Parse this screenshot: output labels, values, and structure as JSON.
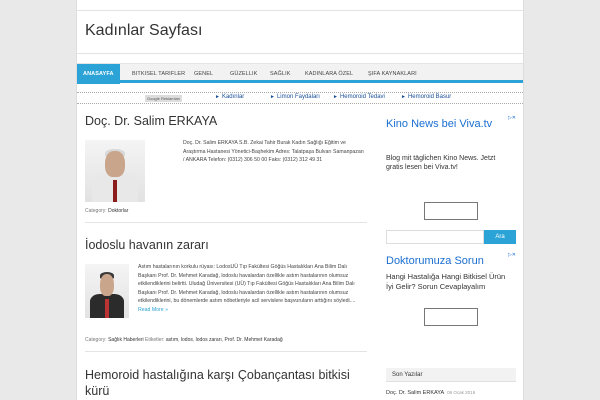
{
  "site": {
    "title": "Kadınlar Sayfası"
  },
  "nav": {
    "items": [
      {
        "label": "ANASAYFA"
      },
      {
        "label": "BITKISEL TARIFLER"
      },
      {
        "label": "GENEL"
      },
      {
        "label": "GÜZELLIK"
      },
      {
        "label": "SAĞLIK"
      },
      {
        "label": "KADINLARA ÖZEL"
      },
      {
        "label": "ŞIFA KAYNAKLARI"
      }
    ]
  },
  "adlinks": {
    "badge": "Google Reklamları",
    "items": [
      {
        "label": "Kadınlar"
      },
      {
        "label": "Limon Faydaları"
      },
      {
        "label": "Hemoroid Tedavi"
      },
      {
        "label": "Hemoroid Basur"
      }
    ]
  },
  "posts": [
    {
      "title": "Doç. Dr. Salim ERKAYA",
      "excerpt": "Doç. Dr. Salim ERKAYA S.B. Zekai Tahir Burak Kadın Sağlığı Eğitim ve Araştırma Hastanesi Yönetici-Başhekim Adres: Talatpaşa Bulvarı Samanpazarı / ANKARA Telefon: (0312) 306 50 00 Faks: (0312) 312 49 31",
      "category_label": "Category:",
      "category": "Doktorlar"
    },
    {
      "title": "İodoslu havanın zararı",
      "excerpt": "Astım hastalarının korkulu rüyası: LodosUÜ Tıp Fakültesi Göğüs Hastalıkları Ana Bilim Dalı Başkanı Prof. Dr. Mehmet Karadağ, lodoslu havalardan özellikle astım hastalarının olumsuz etkilendiklerini belirtti. Uludağ Üniversitesi (UÜ) Tıp Fakültesi Göğüs Hastalıkları Ana Bilim Dalı Başkanı Prof. Dr. Mehmet Karadağ, lodoslu havalardan özellikle astım hastalarının olumsuz etkilendiklerini, bu dönemlerde astım nöbetleriyle acil servislere başvuruların arttığını söyledi....",
      "readmore": "Read More »",
      "category_label": "Category:",
      "category": "Sağlık Haberleri",
      "tags_label": "Etiketler:",
      "tags": [
        "astım",
        "lodos",
        "lodos zararı",
        "Prof. Dr. Mehmet Karadağ"
      ]
    },
    {
      "title": "Hemoroid hastalığına karşı Çobançantası bitkisi kürü"
    }
  ],
  "sidebar": {
    "ad1": {
      "title": "Kino News bei Viva.tv",
      "body": "Blog mit täglichen Kino News. Jetzt gratis lesen bei Viva.tv!"
    },
    "search": {
      "button": "Ara"
    },
    "ad2": {
      "title": "Doktorumuza Sorun",
      "body": "Hangi Hastalığa Hangi Bitkisel Ürün İyi Gelir? Sorun Cevaplayalım"
    },
    "recent": {
      "heading": "Son Yazılar",
      "items": [
        {
          "title": "Doç. Dr. Salim ERKAYA",
          "date": "06 Ocak 2016"
        }
      ]
    }
  }
}
